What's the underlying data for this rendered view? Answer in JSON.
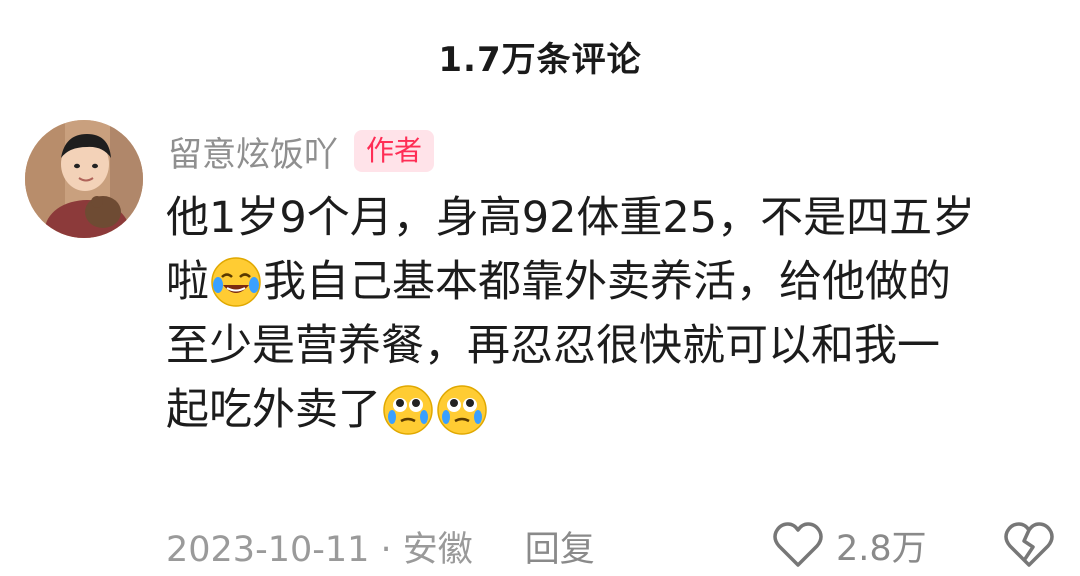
{
  "header": {
    "title": "1.7万条评论"
  },
  "comment": {
    "username": "留意炫饭吖",
    "badge": "作者",
    "lines": {
      "line1": "他1岁9个月，身高92体重25，不是四五岁",
      "line2_a": "啦",
      "line2_b": "我自己基本都靠外卖养活，给他做的",
      "line3": "至少是营养餐，再忍忍很快就可以和我一",
      "line4": "起吃外卖了"
    },
    "emojis": [
      "laughing-crying-emoji",
      "teary-eyed-emoji",
      "teary-eyed-emoji"
    ],
    "date_location": "2023-10-11 · 安徽",
    "reply_label": "回复",
    "like_count": "2.8万"
  },
  "colors": {
    "badge_text": "#ff2d55",
    "badge_bg": "#ffe3e9",
    "username": "#8f8f8f",
    "meta": "#9a9a9a"
  }
}
